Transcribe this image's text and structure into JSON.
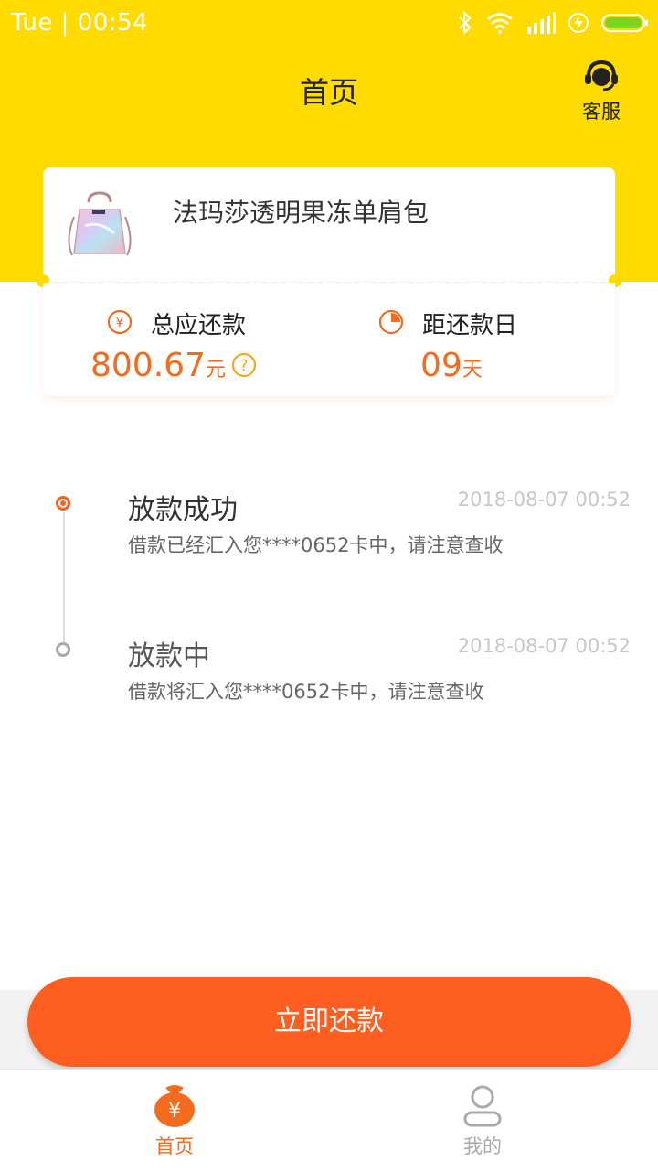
{
  "status_bar": {
    "time": "Tue | 00:54",
    "icons": [
      "bluetooth-icon",
      "wifi-icon",
      "signal-icon",
      "charging-icon",
      "battery-icon"
    ]
  },
  "header": {
    "title": "首页",
    "service_label": "客服"
  },
  "product": {
    "name": "法玛莎透明果冻单肩包",
    "image_icon": "handbag-image"
  },
  "repayment": {
    "total_label": "总应还款",
    "total_amount": "800.67",
    "total_unit": "元",
    "days_label": "距还款日",
    "days_value": "09",
    "days_unit": "天"
  },
  "timeline": [
    {
      "title": "放款成功",
      "time": "2018-08-07 00:52",
      "desc": "借款已经汇入您****0652卡中，请注意查收",
      "status": "done"
    },
    {
      "title": "放款中",
      "time": "2018-08-07 00:52",
      "desc": "借款将汇入您****0652卡中，请注意查收",
      "status": "pending"
    }
  ],
  "actions": {
    "repay_now": "立即还款"
  },
  "tabbar": {
    "home": "首页",
    "mine": "我的"
  },
  "colors": {
    "header_yellow": "#FFDB00",
    "accent_orange": "#F26B1F",
    "button_orange": "#FE5E20",
    "inactive_gray": "#aaaaaa"
  }
}
